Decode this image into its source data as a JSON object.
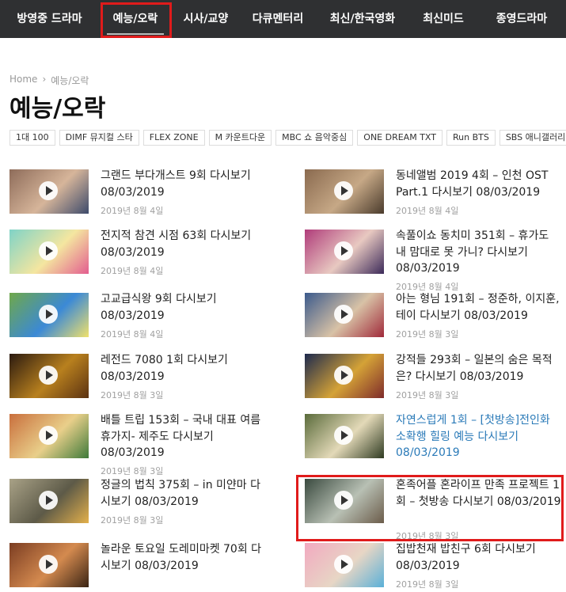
{
  "nav": {
    "items": [
      "방영중 드라마",
      "예능/오락",
      "시사/교양",
      "다큐멘터리",
      "최신/한국영화",
      "최신미드",
      "종영드라마"
    ],
    "active_index": 1,
    "highlight_color": "#e01b1b"
  },
  "breadcrumb": {
    "home": "Home",
    "separator": "›",
    "current": "예능/오락"
  },
  "page_title": "예능/오락",
  "tags": [
    "1대 100",
    "DIMF 뮤지컬 스타",
    "FLEX ZONE",
    "M 카운트다운",
    "MBC 쇼 음악중심",
    "ONE DREAM TXT",
    "Run BTS",
    "SBS 애니갤러리"
  ],
  "posts_left": [
    {
      "title": "그랜드 부다개스트 9회 다시보기 08/03/2019",
      "date": "2019년 8월 4일",
      "thumb_colors": [
        "#8e6c5a",
        "#d6b59a",
        "#3d4a6b"
      ]
    },
    {
      "title": "전지적 참견 시점 63회 다시보기 08/03/2019",
      "date": "2019년 8월 4일",
      "thumb_colors": [
        "#7fd3c7",
        "#f4e6a0",
        "#e35d8f"
      ]
    },
    {
      "title": "고교급식왕 9회 다시보기 08/03/2019",
      "date": "2019년 8월 4일",
      "thumb_colors": [
        "#6fa84a",
        "#3b89d6",
        "#f0e16b"
      ]
    },
    {
      "title": "레전드 7080 1회 다시보기 08/03/2019",
      "date": "2019년 8월 3일",
      "thumb_colors": [
        "#2b1a10",
        "#b8801e",
        "#5b3212"
      ]
    },
    {
      "title": "배틀 트립 153회 – 국내 대표 여름 휴가지- 제주도 다시보기 08/03/2019",
      "date": "2019년 8월 3일",
      "thumb_colors": [
        "#c96f3d",
        "#e9cf8a",
        "#3f7a3a"
      ]
    },
    {
      "title": "정글의 법칙 375회 – in 미얀마 다시보기 08/03/2019",
      "date": "2019년 8월 3일",
      "thumb_colors": [
        "#a9a287",
        "#5d5a48",
        "#e3b04b"
      ]
    },
    {
      "title": "놀라운 토요일 도레미마켓 70회 다시보기 08/03/2019",
      "date": "",
      "thumb_colors": [
        "#7b3d22",
        "#d48a4f",
        "#3a2414"
      ]
    }
  ],
  "posts_right": [
    {
      "title": "동네앨범 2019 4회 – 인천 OST Part.1 다시보기 08/03/2019",
      "date": "2019년 8월 4일",
      "thumb_colors": [
        "#8a6a4f",
        "#c6a886",
        "#4a3b2c"
      ],
      "link": false
    },
    {
      "title": "속풀이쇼 동치미 351회 – 휴가도 내 맘대로 못 가니? 다시보기 08/03/2019",
      "date": "2019년 8월 4일",
      "thumb_colors": [
        "#b03c7a",
        "#e8c9c1",
        "#3c2a59"
      ],
      "link": false
    },
    {
      "title": "아는 형님 191회 – 정준하, 이지훈, 테이 다시보기 08/03/2019",
      "date": "2019년 8월 3일",
      "thumb_colors": [
        "#3b5a8c",
        "#d8c2a6",
        "#a02a3a"
      ],
      "link": false
    },
    {
      "title": "강적들 293회 – 일본의 숨은 목적은? 다시보기 08/03/2019",
      "date": "2019년 8월 3일",
      "thumb_colors": [
        "#1d2a4e",
        "#d4a237",
        "#7e2b2b"
      ],
      "link": false
    },
    {
      "title": "자연스럽게 1회 – [첫방송]전인화 소확행 힐링 예능 다시보기 08/03/2019",
      "date": "",
      "thumb_colors": [
        "#5a6b3b",
        "#e3d9b8",
        "#2f3b22"
      ],
      "link": true
    },
    {
      "title": "혼족어플 혼라이프 만족 프로젝트 1회 – 첫방송 다시보기 08/03/2019",
      "date": "2019년 8월 3일",
      "thumb_colors": [
        "#3a4a3f",
        "#b8c0b4",
        "#6b5c4a"
      ],
      "link": false
    },
    {
      "title": "집밥천재 밥친구 6회 다시보기 08/03/2019",
      "date": "2019년 8월 3일",
      "thumb_colors": [
        "#f2a9c0",
        "#e7d6c5",
        "#5ab0d8"
      ],
      "link": false
    }
  ]
}
